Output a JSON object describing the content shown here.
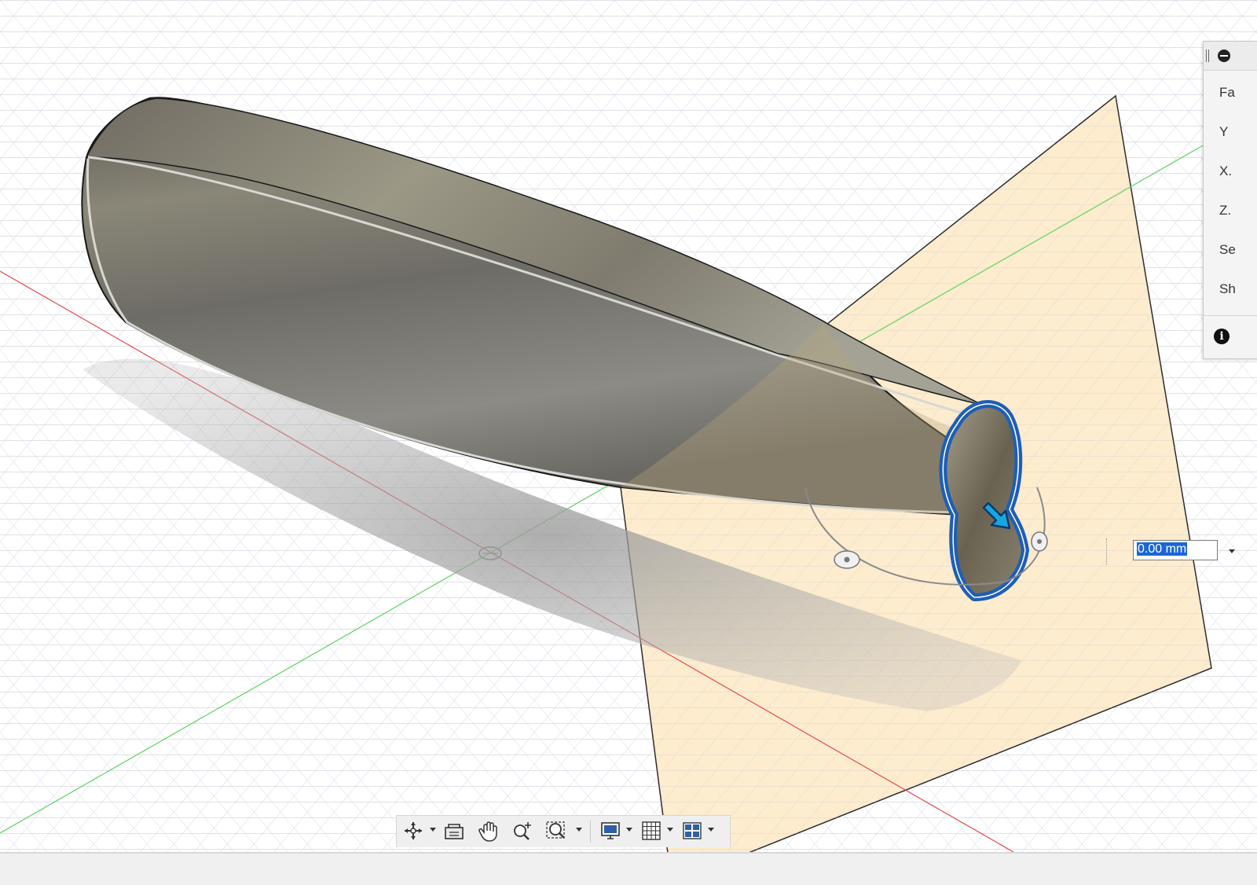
{
  "dimension": {
    "value": "0.00 mm"
  },
  "panel": {
    "rows": [
      "Fa",
      "Y",
      "X.",
      "Z.",
      "Se",
      "Sh"
    ]
  },
  "colors": {
    "x_axis": "#e64b4b",
    "y_axis": "#5fd35f",
    "plane_fill": "#fde9c6",
    "grid_line": "#c7ccd6",
    "selection_blue": "#1e5fb5",
    "arrow_cyan": "#16a6e0"
  },
  "navbar": {
    "icons": [
      "orbit-icon",
      "look-at-icon",
      "pan-icon",
      "zoom-icon",
      "zoom-window-icon",
      "display-settings-icon",
      "grid-settings-icon",
      "viewports-icon"
    ]
  }
}
